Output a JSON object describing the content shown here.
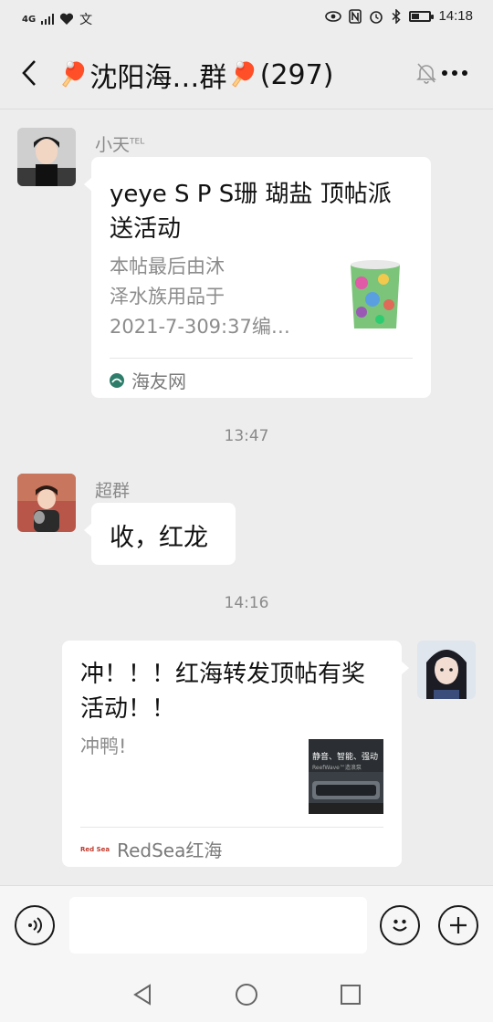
{
  "status_bar": {
    "network": "4G",
    "time": "14:18",
    "icons": [
      "signal-icon",
      "heart-icon",
      "translate-icon",
      "eye-icon",
      "nfc-icon",
      "alarm-icon",
      "bluetooth-icon",
      "battery-icon"
    ]
  },
  "header": {
    "title_text": "沈阳海…群",
    "member_count": "(297)",
    "title_emoji": "🏓"
  },
  "messages": [
    {
      "sender": "小天",
      "sender_tag": "TEL",
      "card": {
        "title": "yeye S P S珊 瑚盐 顶帖派送活动",
        "desc_lines": [
          "本帖最后由沐",
          "泽水族用品于",
          "2021-7-309:37编…"
        ],
        "source": "海友网"
      }
    },
    {
      "time": "13:47"
    },
    {
      "sender": "超群",
      "text": "收，红龙"
    },
    {
      "time": "14:16"
    },
    {
      "self": true,
      "card": {
        "title": "冲！！！红海转发顶帖有奖活动！！",
        "desc": "冲鸭!",
        "thumb_text": "静音、智能、强动",
        "thumb_subtext": "ReefWave™造浪泵",
        "source": "RedSea红海",
        "source_logo": "Red Sea"
      }
    }
  ],
  "colors": {
    "background": "#ededed",
    "bubble": "#ffffff",
    "meta_text": "#8a8a8a"
  }
}
